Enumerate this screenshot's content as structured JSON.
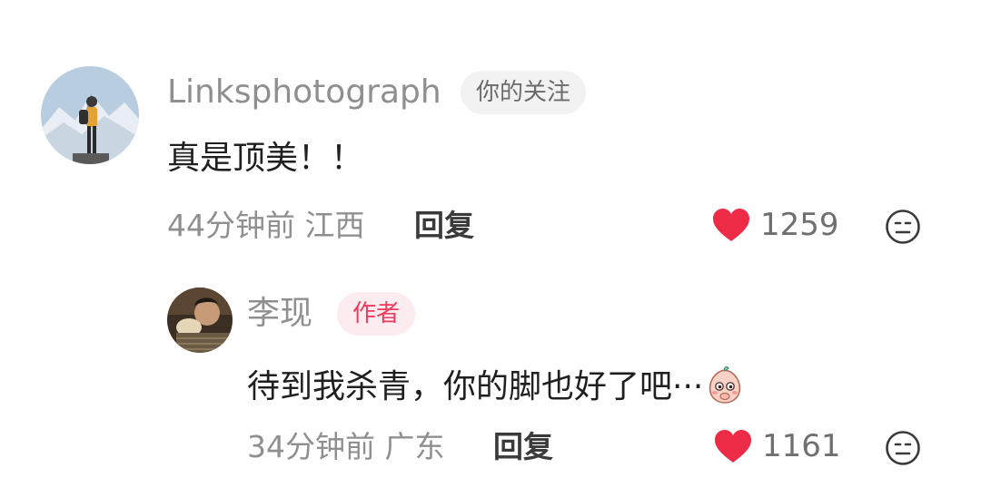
{
  "comments": [
    {
      "username": "Linksphotograph",
      "badge": "你的关注",
      "text": "真是顶美！！",
      "time_location": "44分钟前 江西",
      "reply_label": "回复",
      "likes": "1259"
    },
    {
      "username": "李现",
      "badge": "作者",
      "text": "待到我杀青，你的脚也好了吧···",
      "time_location": "34分钟前 广东",
      "reply_label": "回复",
      "likes": "1161"
    }
  ],
  "colors": {
    "like_red": "#ee2b47",
    "author_badge_text": "#ef3a5d",
    "author_badge_bg": "#fdecef",
    "follow_badge_bg": "#f2f2f2",
    "meta_gray": "#8f8f8f"
  },
  "icons": {
    "like": "heart-icon",
    "dislike": "dislike-face-icon",
    "sticker": "shy-peach-sticker-icon"
  }
}
